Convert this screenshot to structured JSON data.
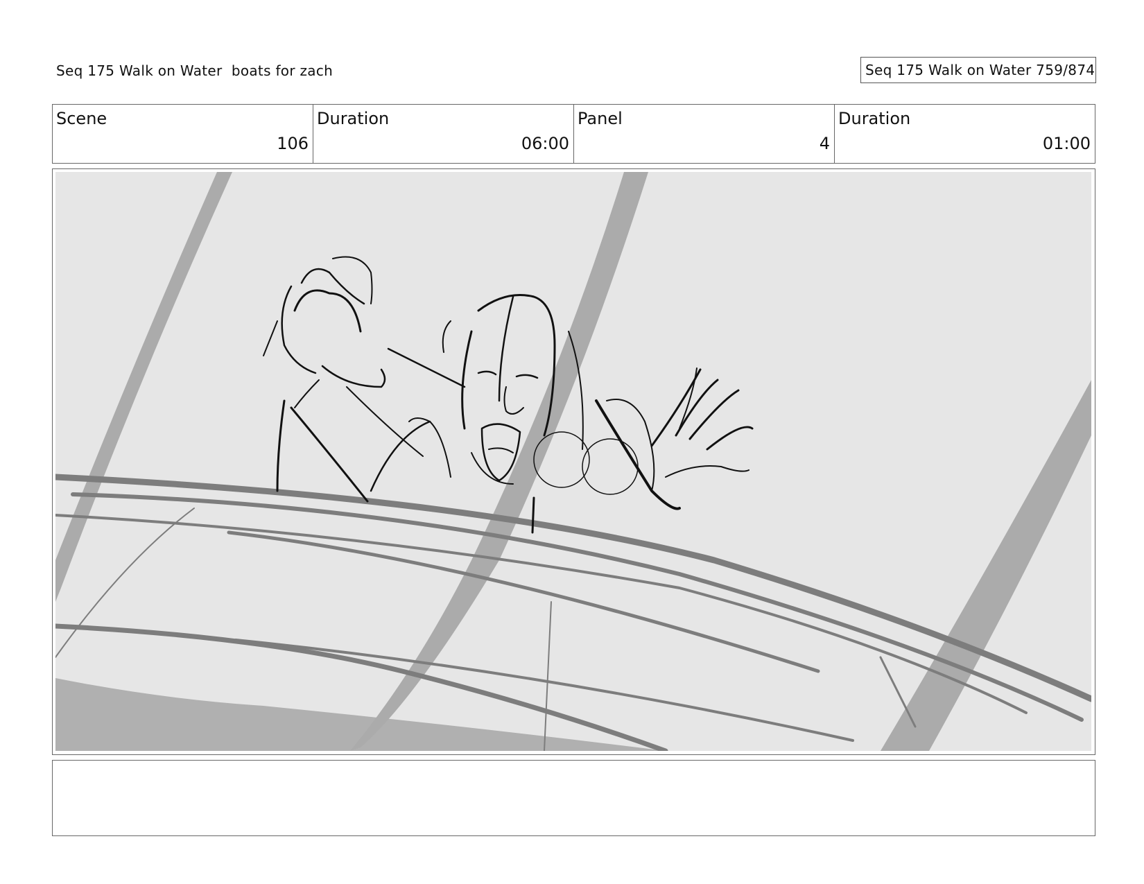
{
  "header": {
    "left_title": "Seq 175 Walk on Water  boats for zach",
    "right_page": "Seq 175 Walk on Water 759/874"
  },
  "info": [
    {
      "label": "Scene",
      "value": "106"
    },
    {
      "label": "Duration",
      "value": "06:00"
    },
    {
      "label": "Panel",
      "value": "4"
    },
    {
      "label": "Duration",
      "value": "01:00"
    }
  ],
  "panel": {
    "image": "storyboard-sketch",
    "background_color": "#e6e6e6",
    "shadow_color": "#b0b0b0",
    "ink_color": "#111111"
  },
  "notes": ""
}
